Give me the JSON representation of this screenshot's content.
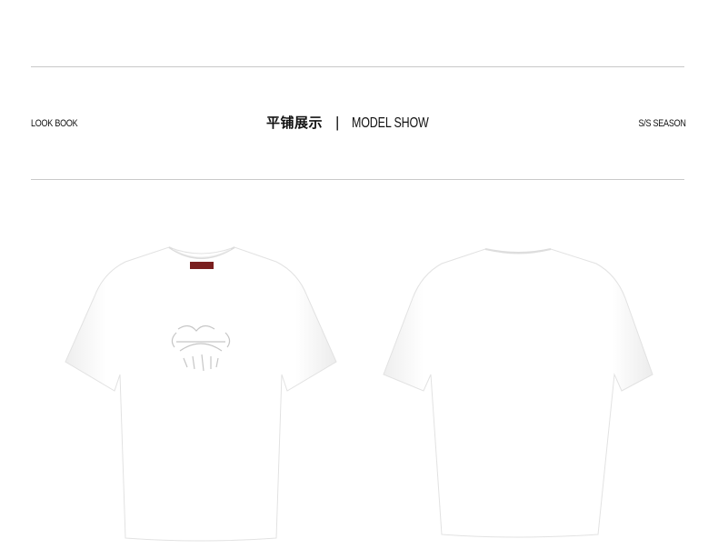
{
  "header": {
    "left_label": "LOOK BOOK",
    "title_cn": "平铺展示",
    "separator": "|",
    "title_en": "MODEL SHOW",
    "right_label": "S/S SEASON"
  },
  "products": [
    {
      "view": "front",
      "color": "#ffffff",
      "has_print": true,
      "has_neck_label": true
    },
    {
      "view": "back",
      "color": "#ffffff",
      "has_print": false,
      "has_neck_label": false
    }
  ],
  "colors": {
    "rule": "#c9c9c9",
    "text": "#111111",
    "shirt_shadow": "#e6e6e6"
  }
}
